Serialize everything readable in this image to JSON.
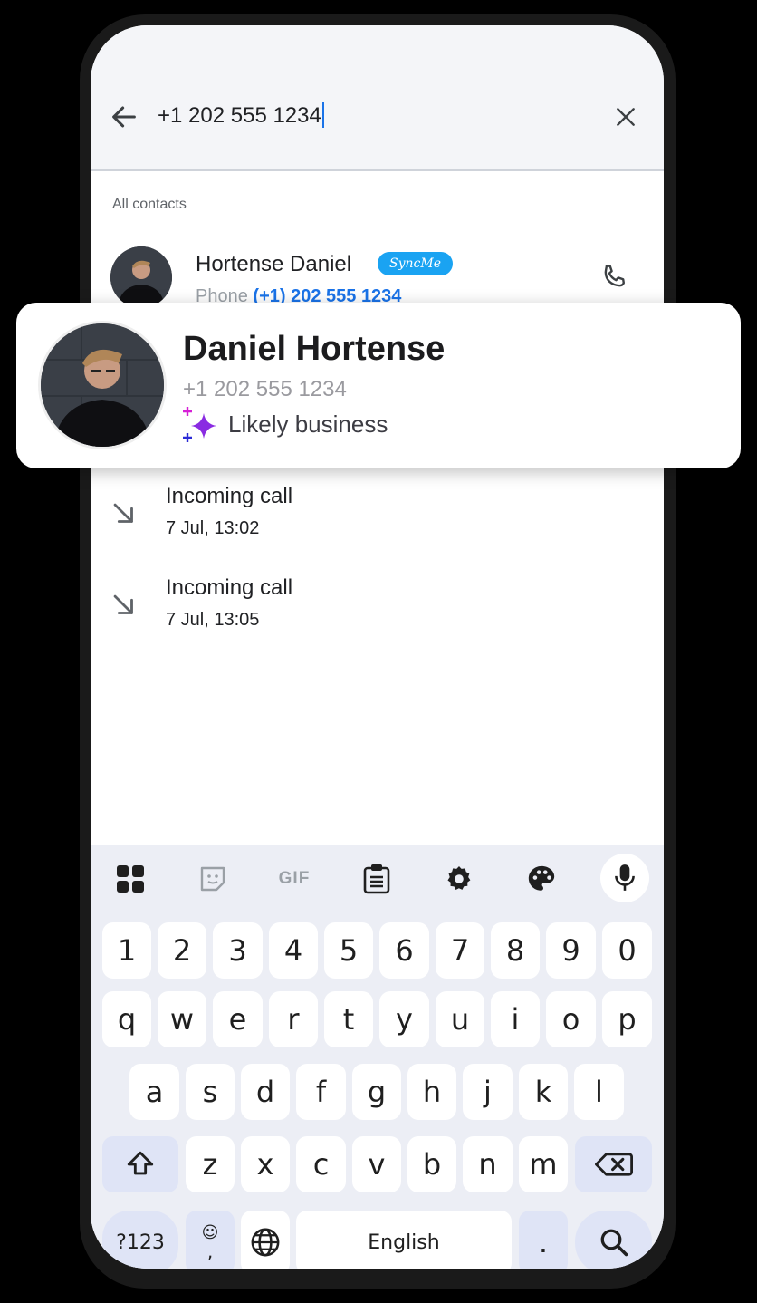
{
  "search": {
    "query": "+1 202 555 1234"
  },
  "section_label": "All contacts",
  "contact": {
    "name": "Hortense Daniel",
    "badge": "SyncMe",
    "phone_label": "Phone",
    "phone": "(+1) 202 555 1234"
  },
  "popup": {
    "name": "Daniel Hortense",
    "phone": "+1 202 555 1234",
    "tag": "Likely business"
  },
  "calls": [
    {
      "title": "Incoming call",
      "time": "7 Jul, 13:02"
    },
    {
      "title": "Incoming call",
      "time": "7 Jul, 13:05"
    }
  ],
  "keyboard": {
    "toolbar": [
      "apps-icon",
      "sticker-icon",
      "GIF",
      "clipboard-icon",
      "settings-icon",
      "palette-icon",
      "mic-icon"
    ],
    "row1": [
      "1",
      "2",
      "3",
      "4",
      "5",
      "6",
      "7",
      "8",
      "9",
      "0"
    ],
    "row2": [
      "q",
      "w",
      "e",
      "r",
      "t",
      "y",
      "u",
      "i",
      "o",
      "p"
    ],
    "row3": [
      "a",
      "s",
      "d",
      "f",
      "g",
      "h",
      "j",
      "k",
      "l"
    ],
    "row4": [
      "z",
      "x",
      "c",
      "v",
      "b",
      "n",
      "m"
    ],
    "symbols": "?123",
    "comma": ",",
    "space": "English",
    "period": "."
  },
  "colors": {
    "accent": "#1a73e8",
    "badge": "#1aa3f2",
    "sparkle": "#8a2be2"
  }
}
